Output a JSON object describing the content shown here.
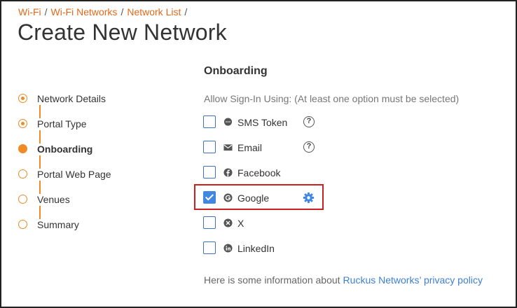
{
  "breadcrumb": {
    "items": [
      {
        "label": "Wi-Fi"
      },
      {
        "label": "Wi-Fi Networks"
      },
      {
        "label": "Network List"
      }
    ],
    "separator": "/"
  },
  "page": {
    "title": "Create New Network"
  },
  "steps": [
    {
      "label": "Network Details",
      "state": "done"
    },
    {
      "label": "Portal Type",
      "state": "done"
    },
    {
      "label": "Onboarding",
      "state": "active"
    },
    {
      "label": "Portal Web Page",
      "state": "pending"
    },
    {
      "label": "Venues",
      "state": "pending"
    },
    {
      "label": "Summary",
      "state": "pending"
    }
  ],
  "onboarding": {
    "title": "Onboarding",
    "hint": "Allow Sign-In Using: (At least one option must be selected)",
    "options": [
      {
        "label": "SMS Token",
        "icon": "sms-icon",
        "checked": false,
        "help": "?"
      },
      {
        "label": "Email",
        "icon": "envelope-icon",
        "checked": false,
        "help": "?"
      },
      {
        "label": "Facebook",
        "icon": "facebook-icon",
        "checked": false
      },
      {
        "label": "Google",
        "icon": "google-icon",
        "checked": true,
        "settings": "gear-icon"
      },
      {
        "label": "X",
        "icon": "x-icon",
        "checked": false
      },
      {
        "label": "LinkedIn",
        "icon": "linkedin-icon",
        "checked": false
      }
    ]
  },
  "footer": {
    "text": "Here is some information about",
    "link": "Ruckus Networks’ privacy policy"
  },
  "colors": {
    "accent_orange": "#f08a24",
    "link_orange": "#e06a1b",
    "checkbox_blue": "#3f87e0",
    "link_blue": "#3d7fd6",
    "highlight_red": "#cc1f1f"
  }
}
